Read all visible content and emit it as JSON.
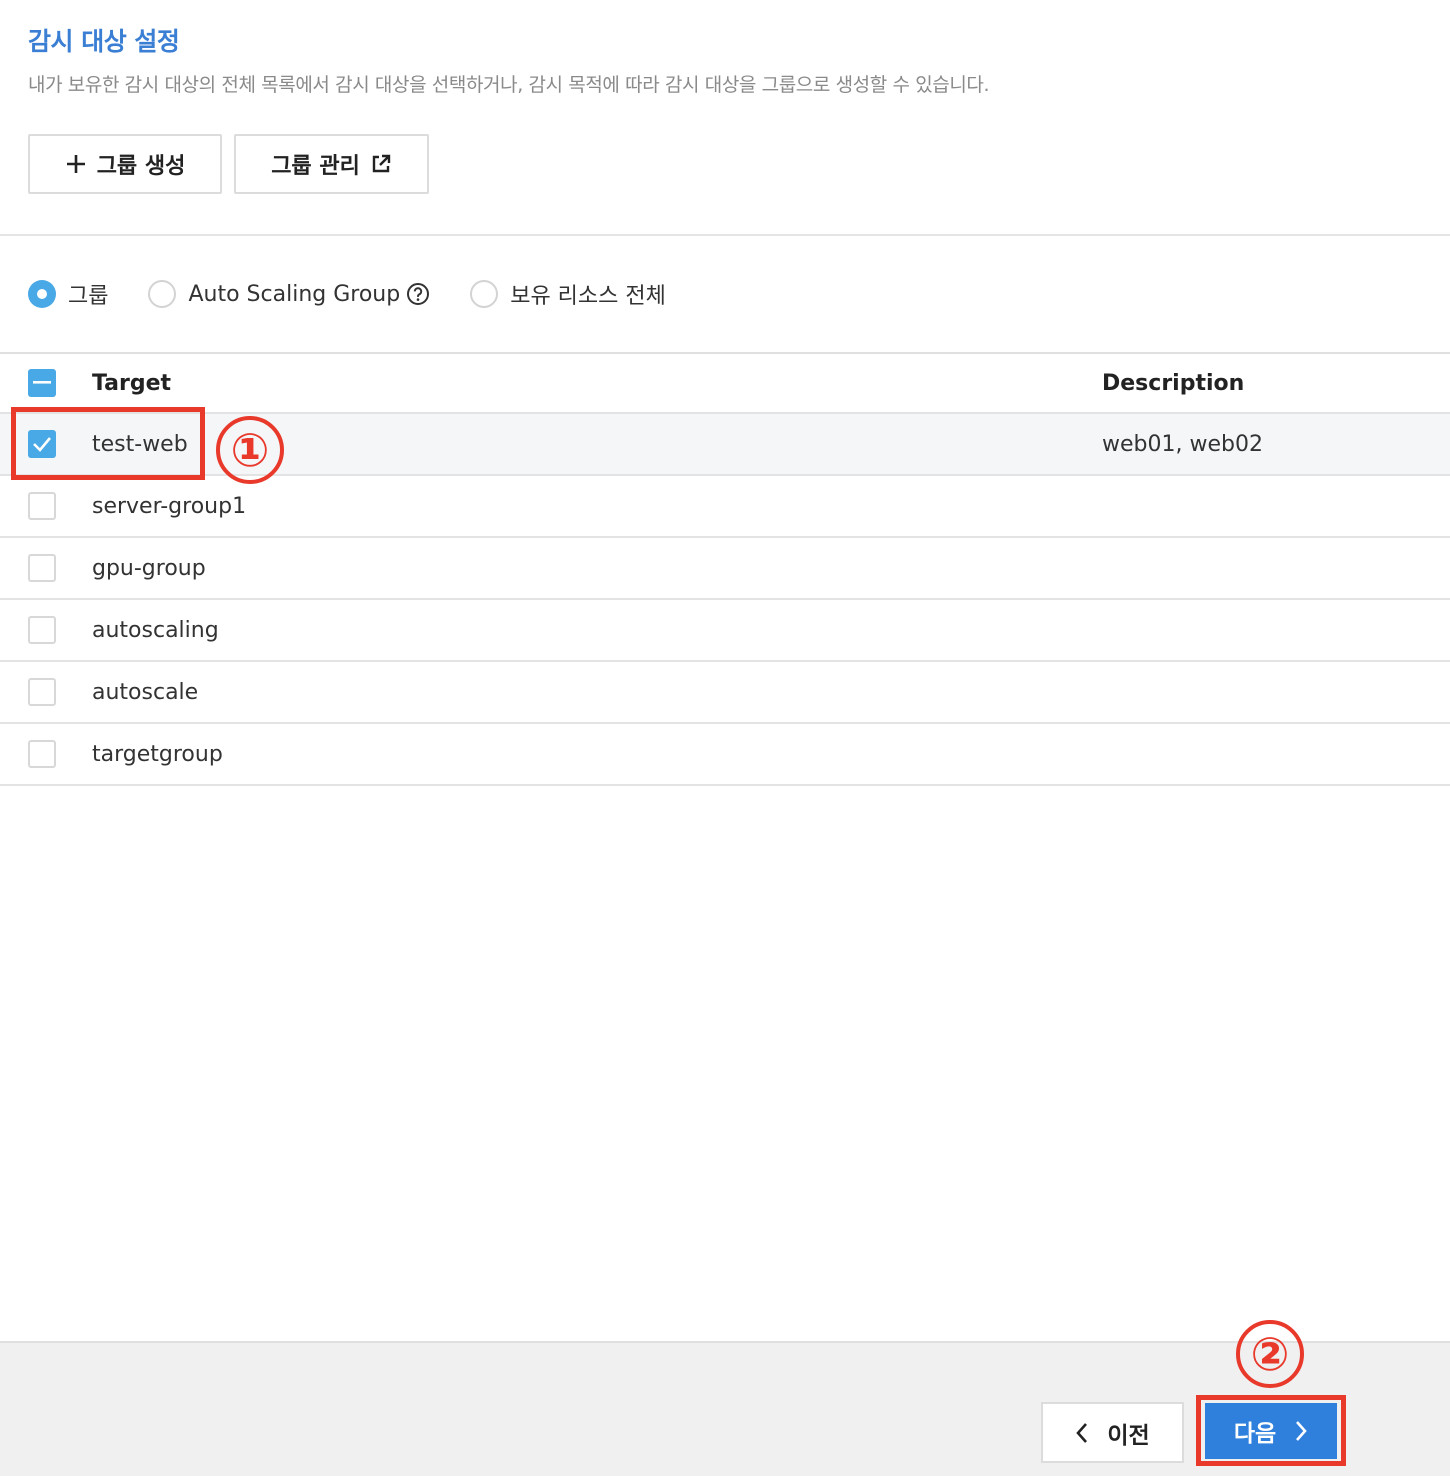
{
  "header": {
    "title": "감시 대상 설정",
    "description": "내가 보유한 감시 대상의 전체 목록에서 감시 대상을 선택하거나, 감시 목적에 따라 감시 대상을 그룹으로 생성할 수 있습니다."
  },
  "toolbar": {
    "create_group_label": "그룹 생성",
    "manage_group_label": "그룹 관리",
    "create_icon": "plus-icon",
    "manage_icon": "external-link-icon"
  },
  "filter": {
    "options": [
      {
        "label": "그룹",
        "selected": true
      },
      {
        "label": "Auto Scaling Group",
        "selected": false,
        "icon": "help-icon"
      },
      {
        "label": "보유 리소스 전체",
        "selected": false
      }
    ]
  },
  "table": {
    "header_checkbox_state": "partial",
    "columns": [
      "Target",
      "Description"
    ],
    "rows": [
      {
        "target": "test-web",
        "description": "web01, web02",
        "checked": true
      },
      {
        "target": "server-group1",
        "description": "",
        "checked": false
      },
      {
        "target": "gpu-group",
        "description": "",
        "checked": false
      },
      {
        "target": "autoscaling",
        "description": "",
        "checked": false
      },
      {
        "target": "autoscale",
        "description": "",
        "checked": false
      },
      {
        "target": "targetgroup",
        "description": "",
        "checked": false
      }
    ]
  },
  "annotations": {
    "step1": "①",
    "step2": "②",
    "color": "#e8392b"
  },
  "footer": {
    "prev_label": "이전",
    "next_label": "다음"
  },
  "colors": {
    "accent": "#3b7fd4",
    "checkbox": "#49a8e6",
    "primary_button": "#2f7fdc"
  }
}
